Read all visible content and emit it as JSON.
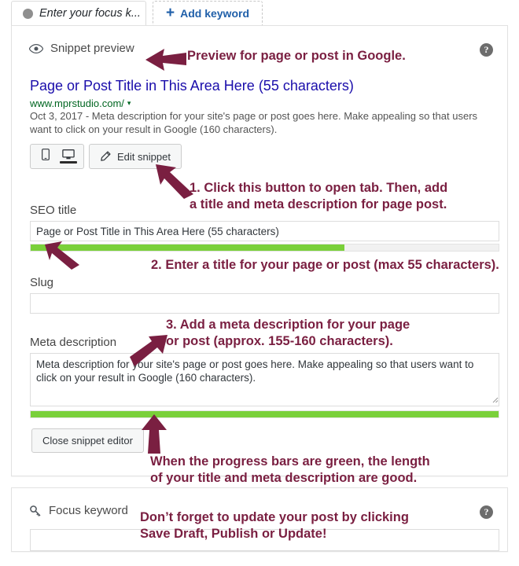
{
  "tabs": {
    "active": {
      "label": "Enter your focus k...",
      "dot_icon": "circle-icon"
    },
    "add": {
      "label": "Add keyword",
      "icon": "plus-icon"
    }
  },
  "snippet_panel": {
    "header_label": "Snippet preview",
    "header_icon": "eye-icon",
    "help_icon": "?",
    "google_preview": {
      "title": "Page or Post Title in This Area Here (55 characters)",
      "url": "www.mprstudio.com/",
      "url_caret": "▾",
      "date": "Oct 3, 2017 - ",
      "description": "Meta description for your site's page or post goes here. Make appealing so that users want to click on your result in Google (160 characters)."
    },
    "device_toggle": {
      "mobile_label": "mobile-view",
      "desktop_label": "desktop-view",
      "selected": "desktop"
    },
    "edit_snippet_label": "Edit snippet",
    "edit_snippet_icon": "pencil-icon",
    "seo_title": {
      "label": "SEO title",
      "value": "Page or Post Title in This Area Here (55 characters)",
      "progress_percent": 67,
      "progress_color": "#7ad03a"
    },
    "slug": {
      "label": "Slug",
      "value": "",
      "placeholder": ""
    },
    "meta_description": {
      "label": "Meta description",
      "value": "Meta description for your site's page or post goes here. Make appealing so that users want to click on your result in Google (160 characters).",
      "progress_percent": 100,
      "progress_color": "#7ad03a"
    },
    "close_editor_label": "Close snippet editor"
  },
  "focus_keyword_panel": {
    "header_label": "Focus keyword",
    "header_icon": "key-icon",
    "help_icon": "?",
    "input_value": "",
    "input_placeholder": ""
  },
  "annotations": {
    "color": "#7a1f41",
    "note1": "Preview for page or post in Google.",
    "note2": "1. Click this button to open tab. Then, add\na title and meta description for page post.",
    "note3": "2. Enter a title for your page or post (max 55 characters).",
    "note4": "3. Add a meta description for your page\nor post (approx. 155-160 characters).",
    "note5": "When the progress bars are green, the length\nof your title and meta description are good.",
    "note6": "Don’t forget to update your post by clicking\nSave Draft, Publish or Update!"
  }
}
